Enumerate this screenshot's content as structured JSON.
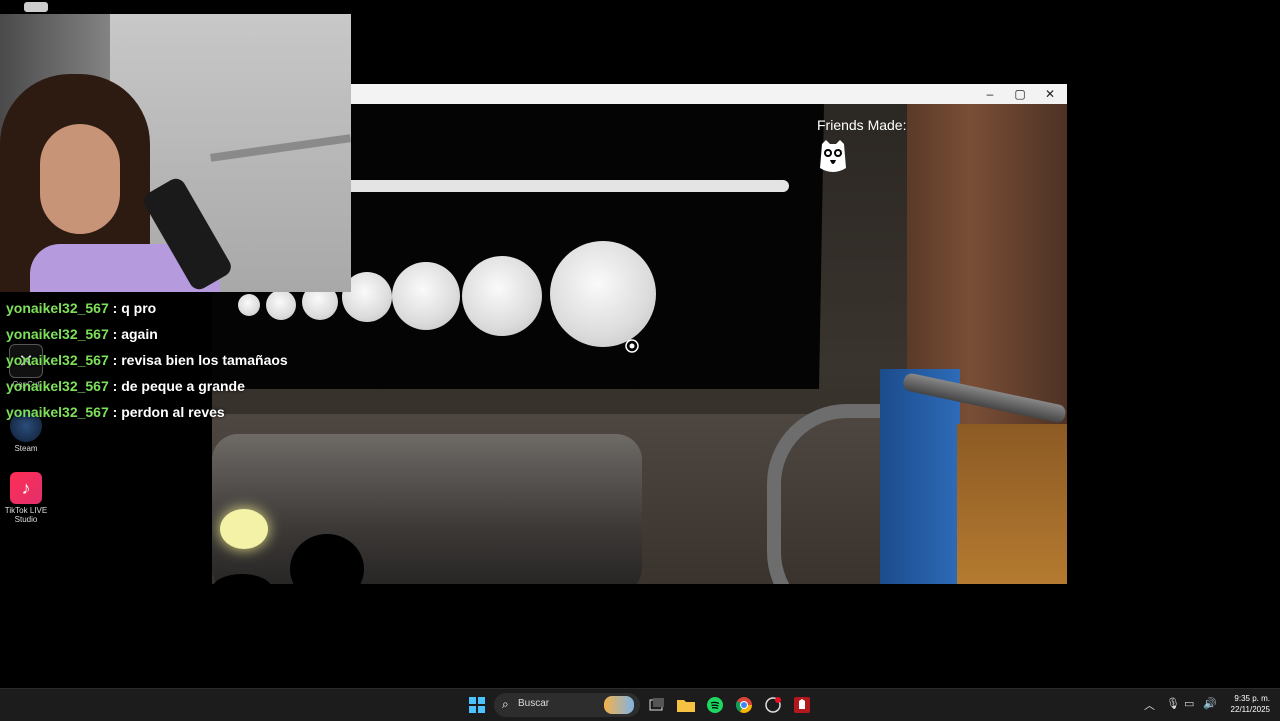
{
  "desktop": {
    "icons": [
      {
        "label": "CapCut"
      },
      {
        "label": "Steam"
      },
      {
        "label": "TikTok LIVE Studio"
      }
    ]
  },
  "game": {
    "friends_label": "Friends Made:",
    "progress_fraction": 1.0,
    "sphere_count": 8
  },
  "chat": {
    "messages": [
      {
        "user": "yonaikel32_567",
        "text": "q pro"
      },
      {
        "user": "yonaikel32_567",
        "text": "again"
      },
      {
        "user": "yonaikel32_567",
        "text": "revisa bien los tamañaos"
      },
      {
        "user": "yonaikel32_567",
        "text": "de peque a grande"
      },
      {
        "user": "yonaikel32_567",
        "text": "perdon al reves"
      }
    ],
    "separator": ":"
  },
  "taskbar": {
    "search_placeholder": "Buscar",
    "time": "9:35 p. m.",
    "date": "22/11/2025"
  },
  "colors": {
    "chat_user": "#7ee05a",
    "taskbar_bg": "#1c1c1c",
    "blue_handle": "#2e6bb8"
  }
}
